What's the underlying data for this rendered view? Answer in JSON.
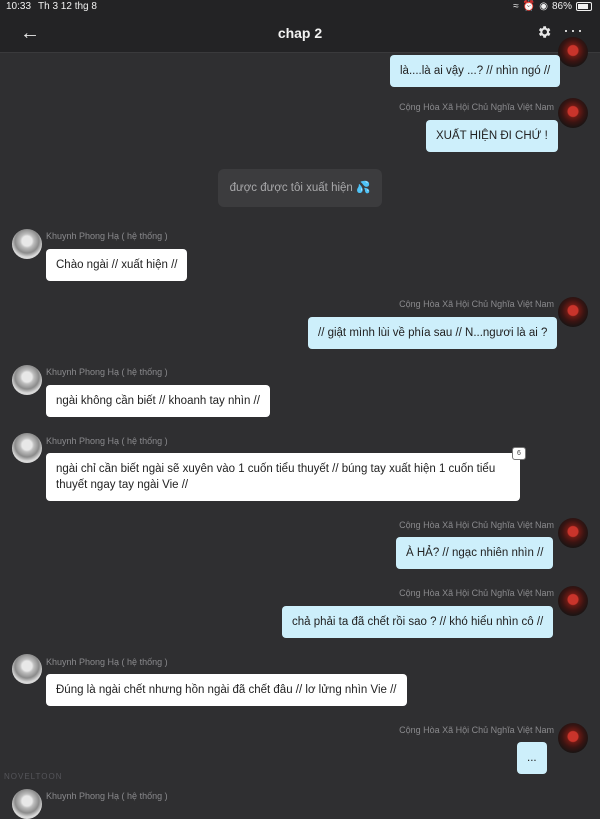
{
  "status_bar": {
    "time": "10:33",
    "date": "Th 3 12 thg 8",
    "battery": "86%"
  },
  "header": {
    "title": "chap 2"
  },
  "system_message": "được được tôi xuất hiện 💦",
  "messages": [
    {
      "sender": "Cộng Hòa Xã Hội Chủ Nghĩa Việt Nam",
      "text": "là....là ai vậy ...? // nhìn ngó //"
    },
    {
      "sender": "Cộng Hòa Xã Hội Chủ Nghĩa Việt Nam",
      "text": "XUẤT HIỆN ĐI CHỨ !"
    },
    {
      "sender": "Khuynh Phong Hạ ( hệ thống )",
      "text": "Chào ngài // xuất hiện //"
    },
    {
      "sender": "Cộng Hòa Xã Hội Chủ Nghĩa Việt Nam",
      "text": "// giật mình lùi về phía sau // N...ngươi là ai ?"
    },
    {
      "sender": "Khuynh Phong Hạ ( hệ thống )",
      "text": "ngài không cần biết // khoanh tay nhìn //"
    },
    {
      "sender": "Khuynh Phong Hạ ( hệ thống )",
      "text": "ngài chỉ cần biết ngài sẽ xuyên vào 1 cuốn tiểu thuyết // búng tay xuất hiện 1 cuốn tiểu thuyết ngay tay ngài Vie //",
      "badge": "6"
    },
    {
      "sender": "Cộng Hòa Xã Hội Chủ Nghĩa Việt Nam",
      "text": "À HẢ? // ngạc nhiên nhìn //"
    },
    {
      "sender": "Cộng Hòa Xã Hội Chủ Nghĩa Việt Nam",
      "text": "chả phải ta đã chết rồi sao ? // khó hiểu nhìn cô //"
    },
    {
      "sender": "Khuynh Phong Hạ ( hệ thống )",
      "text": "Đúng là ngài chết nhưng hồn ngài đã chết đâu // lơ lửng nhìn Vie //"
    },
    {
      "sender": "Cộng Hòa Xã Hội Chủ Nghĩa Việt Nam",
      "text": "..."
    },
    {
      "sender": "Khuynh Phong Hạ ( hệ thống )",
      "text": ""
    }
  ],
  "watermark": "NOVELTOON"
}
